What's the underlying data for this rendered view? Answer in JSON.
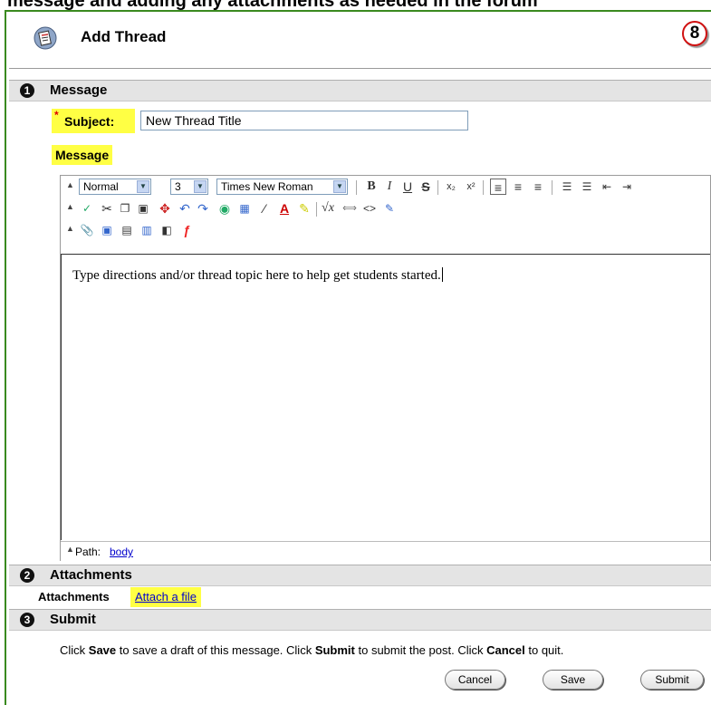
{
  "caption_fragment": "message and adding any attachments as needed in the forum",
  "header": {
    "title": "Add Thread",
    "step_badge": "8"
  },
  "sections": {
    "message": {
      "number": "1",
      "title": "Message"
    },
    "attachments": {
      "number": "2",
      "title": "Attachments"
    },
    "submit": {
      "number": "3",
      "title": "Submit"
    }
  },
  "subject": {
    "required_mark": "*",
    "label": "Subject:",
    "value": "New Thread Title"
  },
  "message_label": "Message",
  "editor": {
    "style_select": "Normal",
    "size_select": "3",
    "font_select": "Times New Roman",
    "content": "Type directions and/or thread topic here to help get students started.",
    "path_label": "Path:",
    "path_value": "body"
  },
  "attachments": {
    "label": "Attachments",
    "link": "Attach a file"
  },
  "submit": {
    "instr": {
      "p1": "Click ",
      "b1": "Save",
      "p2": " to save a draft of this message. Click ",
      "b2": "Submit",
      "p3": " to submit the post. Click ",
      "b3": "Cancel",
      "p4": " to quit."
    },
    "buttons": {
      "cancel": "Cancel",
      "save": "Save",
      "submit": "Submit"
    }
  },
  "icons": [
    "thread-icon",
    "bold-icon",
    "italic-icon",
    "underline-icon",
    "strikethrough-icon",
    "subscript-icon",
    "superscript-icon",
    "align-left-icon",
    "align-center-icon",
    "align-right-icon",
    "ordered-list-icon",
    "unordered-list-icon",
    "outdent-icon",
    "indent-icon",
    "spellcheck-icon",
    "cut-icon",
    "copy-icon",
    "paste-icon",
    "anchor-icon",
    "undo-icon",
    "redo-icon",
    "link-icon",
    "table-icon",
    "horizontal-rule-icon",
    "text-color-icon",
    "highlight-icon",
    "equation-icon",
    "html-toggle-icon",
    "source-icon",
    "preview-icon",
    "attach-icon",
    "image-icon",
    "media-icon",
    "file-icon",
    "mashup-icon",
    "flash-icon"
  ],
  "colors": {
    "highlight": "#ffff44",
    "frame": "#3a8a1f",
    "section_bar": "#e4e4e4",
    "link": "#0000cc"
  }
}
